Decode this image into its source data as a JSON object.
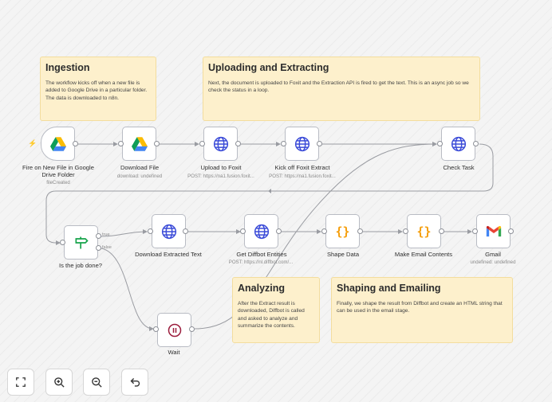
{
  "stickies": {
    "ingestion": {
      "title": "Ingestion",
      "text": "The workflow kicks off when a new file is added to Google Drive in a particular folder. The data is downloaded to n8n."
    },
    "uploading": {
      "title": "Uploading and Extracting",
      "text": "Next, the document is uploaded to Foxit and the Extraction API is fired to get the text. This is an async job so we check the status in a loop."
    },
    "analyzing": {
      "title": "Analyzing",
      "text": "After the Extract result is downloaded, Diffbot is called and asked to analyze and summarize the contents."
    },
    "shaping": {
      "title": "Shaping and Emailing",
      "text": "Finally, we shape the result from Diffbot and create an HTML string that can be used in the email stage."
    }
  },
  "nodes": {
    "trigger": {
      "label": "Fire on New File in Google Drive Folder",
      "sub": "fileCreated",
      "icon": "google-drive-icon"
    },
    "download": {
      "label": "Download File",
      "sub": "download: undefined",
      "icon": "google-drive-icon"
    },
    "upload": {
      "label": "Upload to Foxit",
      "sub": "POST: https://na1.fusion.foxit...",
      "icon": "globe-icon"
    },
    "kickoff": {
      "label": "Kick off Foxit Extract",
      "sub": "POST: https://na1.fusion.foxit...",
      "icon": "globe-icon"
    },
    "check": {
      "label": "Check Task",
      "icon": "globe-icon"
    },
    "isdone": {
      "label": "Is the job done?",
      "true_label": "true",
      "false_label": "false",
      "icon": "signpost-icon"
    },
    "extracted": {
      "label": "Download Extracted Text",
      "icon": "globe-icon"
    },
    "diffbot": {
      "label": "Get Diffbot Entities",
      "sub": "POST: https://nl.diffbot.com/...",
      "icon": "globe-icon"
    },
    "shape": {
      "label": "Shape Data",
      "icon": "code-braces-icon"
    },
    "email": {
      "label": "Make Email Contents",
      "icon": "code-braces-icon"
    },
    "gmail": {
      "label": "Gmail",
      "sub": "undefined: undefined",
      "icon": "gmail-icon"
    },
    "wait": {
      "label": "Wait",
      "icon": "pause-icon"
    }
  },
  "controls": [
    "fit-view-icon",
    "zoom-in-icon",
    "zoom-out-icon",
    "undo-icon"
  ],
  "colors": {
    "canvas": "#f4f4f4",
    "sticky": "#fdf0cc",
    "globe": "#3b4bd8",
    "braces": "#f59e0b",
    "wait": "#9b1c3c",
    "signpost": "#16a34a",
    "trigger_bolt": "#ff6d5a"
  }
}
